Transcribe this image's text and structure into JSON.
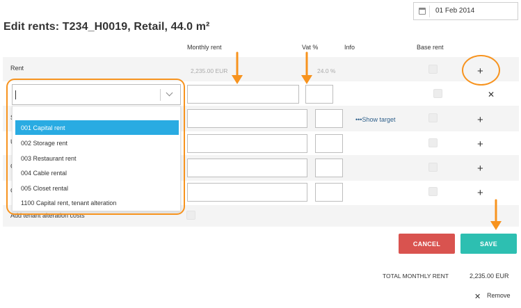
{
  "header": {
    "date": "01 Feb 2014",
    "title": "Edit rents: T234_H0019, Retail, 44.0 m²"
  },
  "columns": {
    "monthly_rent": "Monthly rent",
    "vat": "Vat %",
    "info": "Info",
    "base_rent": "Base rent"
  },
  "rent_row": {
    "label": "Rent",
    "monthly_rent": "2,235.00 EUR",
    "vat": "24.0 %"
  },
  "new_rent_row": {
    "search_value": "",
    "monthly_rent_value": "",
    "vat_value": ""
  },
  "rows": [
    {
      "letter": "S",
      "link": "•••Show target"
    },
    {
      "letter": "U"
    },
    {
      "letter": "C"
    },
    {
      "letter": "C"
    }
  ],
  "dropdown": {
    "options": [
      "001 Capital rent",
      "002 Storage rent",
      "003 Restaurant rent",
      "004 Cable rental",
      "005 Closet rental",
      "1100 Capital rent, tenant alteration"
    ],
    "highlighted_index": 0
  },
  "alteration": {
    "label": "Add tenant alteration costs"
  },
  "actions": {
    "cancel": "CANCEL",
    "save": "SAVE"
  },
  "totals": {
    "label": "TOTAL MONTHLY RENT",
    "value": "2,235.00 EUR",
    "remove": "Remove"
  },
  "icons": {
    "add": "+",
    "close": "✕",
    "calendar": "calendar-icon",
    "chevron": "chevron-down-icon"
  },
  "colors": {
    "annotation": "#f7931e",
    "cancel": "#d9534f",
    "save": "#2dbfb1",
    "highlight": "#29abe2",
    "link": "#2e5f8a"
  }
}
